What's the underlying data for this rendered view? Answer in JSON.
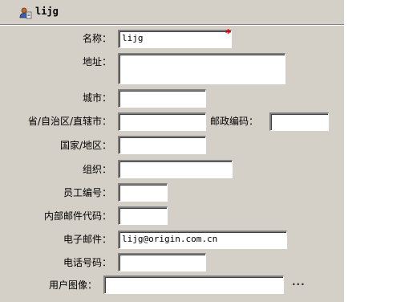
{
  "title": "lijg",
  "required_mark": "*",
  "fields": {
    "name": {
      "label": "名称：",
      "value": "lijg"
    },
    "address": {
      "label": "地址：",
      "value": ""
    },
    "city": {
      "label": "城市：",
      "value": ""
    },
    "province": {
      "label": "省/自治区/直辖市：",
      "value": ""
    },
    "postal_code": {
      "label": "邮政编码：",
      "value": ""
    },
    "country": {
      "label": "国家/地区：",
      "value": ""
    },
    "organization": {
      "label": "组织：",
      "value": ""
    },
    "employee_number": {
      "label": "员工编号：",
      "value": ""
    },
    "internal_mail_code": {
      "label": "内部邮件代码：",
      "value": ""
    },
    "email": {
      "label": "电子邮件：",
      "value": "lijg@origin.com.cn"
    },
    "phone": {
      "label": "电话号码：",
      "value": ""
    },
    "user_image": {
      "label": "用户图像：",
      "value": ""
    }
  },
  "browse_label": "..."
}
